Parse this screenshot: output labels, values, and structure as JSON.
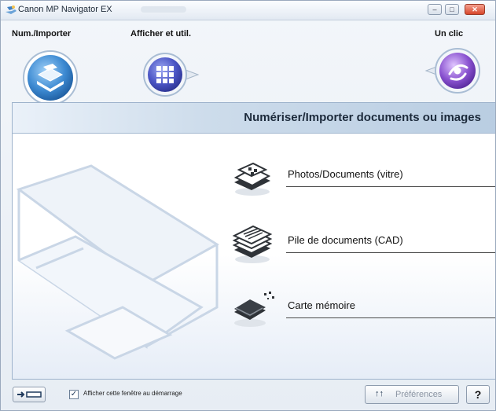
{
  "window": {
    "title": "Canon MP Navigator EX",
    "controls": {
      "minimize": "–",
      "maximize": "□",
      "close": "✕"
    }
  },
  "modes": [
    {
      "label": "Num./Importer",
      "icon": "scanner-icon",
      "selected": true
    },
    {
      "label": "Afficher et util.",
      "icon": "grid-view-icon",
      "selected": false
    },
    {
      "label": "Un clic",
      "icon": "one-click-icon",
      "selected": false
    }
  ],
  "panel": {
    "title": "Numériser/Importer documents ou images",
    "actions": [
      {
        "label": "Photos/Documents (vitre)",
        "icon": "photos-documents-platen-icon"
      },
      {
        "label": "Pile de documents (CAD)",
        "icon": "document-stack-adf-icon"
      },
      {
        "label": "Carte mémoire",
        "icon": "memory-card-icon"
      }
    ]
  },
  "footer": {
    "show_window_checkbox": {
      "label": "Afficher cette fenêtre au démarrage",
      "checked": true
    },
    "preferences_label": "Préférences",
    "help_label": "?"
  },
  "colors": {
    "accent_blue": "#3f86cf",
    "header_blue": "#c3d4e7",
    "purple_mode": "#7f55c8"
  }
}
